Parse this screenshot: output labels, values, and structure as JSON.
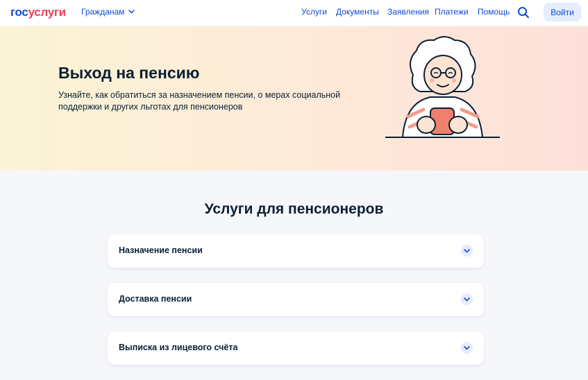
{
  "header": {
    "logo_part1": "гос",
    "logo_part2": "услуги",
    "audience": "Гражданам",
    "nav": [
      "Услуги",
      "Документы",
      "Заявления",
      "Платежи",
      "Помощь"
    ],
    "login": "Войти"
  },
  "hero": {
    "title": "Выход на пенсию",
    "description": "Узнайте, как обратиться за назначением пенсии, о мерах социальной поддержки и других льготах для пенсионеров"
  },
  "services": {
    "title": "Услуги для пенсионеров",
    "items": [
      "Назначение пенсии",
      "Доставка пенсии",
      "Выписка из лицевого счёта"
    ]
  },
  "colors": {
    "brand_blue": "#0d4cd3",
    "brand_red": "#ee3f58",
    "text": "#0b1f33",
    "page_bg": "#f5f7fb"
  }
}
